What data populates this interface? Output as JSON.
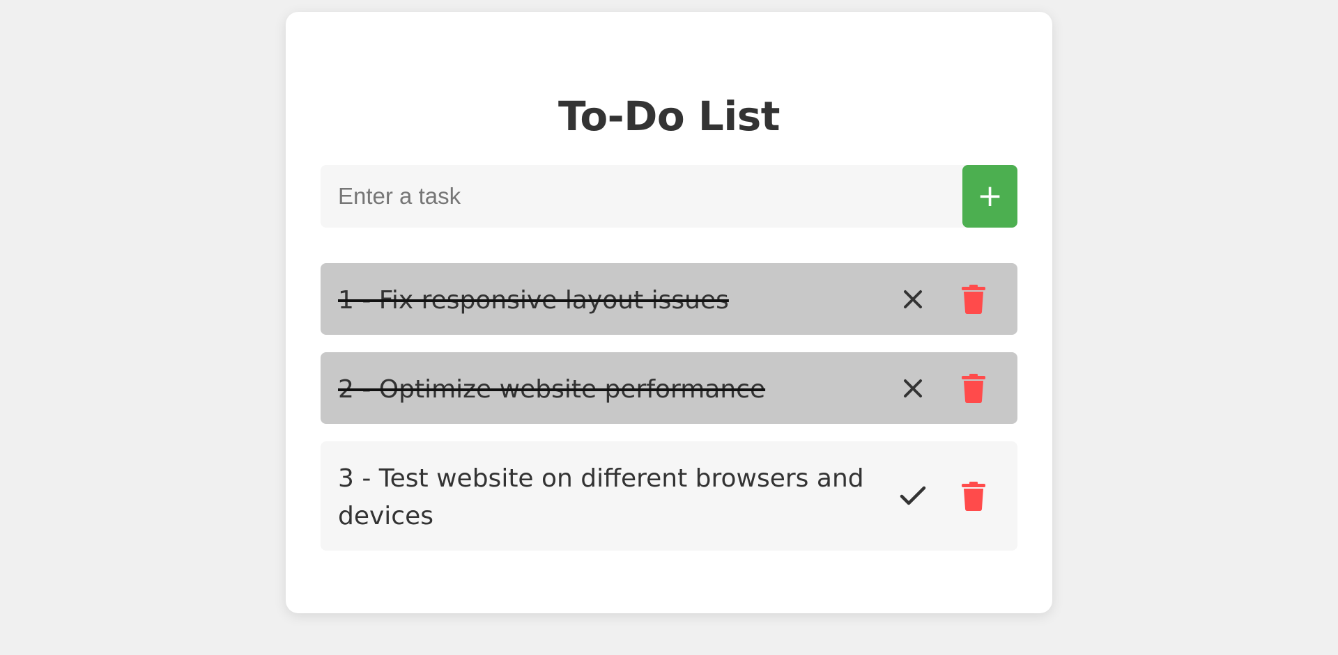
{
  "title": "To-Do List",
  "input": {
    "placeholder": "Enter a task",
    "value": ""
  },
  "add_button_label": "+",
  "colors": {
    "add_button": "#4caf50",
    "delete_icon": "#ff4b4b",
    "done_row": "#c8c8c8",
    "open_row": "#f6f6f6"
  },
  "tasks": [
    {
      "text": "1 - Fix responsive layout issues",
      "completed": true,
      "toggle_icon": "close-icon",
      "delete_icon": "trash-icon"
    },
    {
      "text": "2 - Optimize website performance",
      "completed": true,
      "toggle_icon": "close-icon",
      "delete_icon": "trash-icon"
    },
    {
      "text": "3 - Test website on different browsers and devices",
      "completed": false,
      "toggle_icon": "check-icon",
      "delete_icon": "trash-icon"
    }
  ]
}
